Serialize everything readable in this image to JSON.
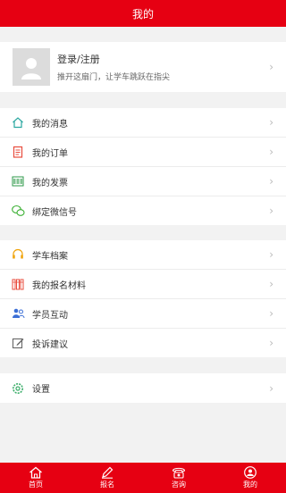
{
  "header": {
    "title": "我的"
  },
  "profile": {
    "title": "登录/注册",
    "subtitle": "推开这扇门，让学车跳跃在指尖"
  },
  "group1": [
    {
      "label": "我的消息",
      "icon": "home-icon"
    },
    {
      "label": "我的订单",
      "icon": "clipboard-icon"
    },
    {
      "label": "我的发票",
      "icon": "barcode-icon"
    },
    {
      "label": "绑定微信号",
      "icon": "wechat-icon"
    }
  ],
  "group2": [
    {
      "label": "学车档案",
      "icon": "headset-icon"
    },
    {
      "label": "我的报名材料",
      "icon": "books-icon"
    },
    {
      "label": "学员互动",
      "icon": "people-icon"
    },
    {
      "label": "投诉建议",
      "icon": "edit-icon"
    }
  ],
  "group3": [
    {
      "label": "设置",
      "icon": "gear-icon"
    }
  ],
  "tabs": [
    {
      "label": "首页",
      "icon": "home-icon"
    },
    {
      "label": "报名",
      "icon": "pen-icon"
    },
    {
      "label": "咨询",
      "icon": "phone-icon"
    },
    {
      "label": "我的",
      "icon": "user-icon"
    }
  ],
  "colors": {
    "brand": "#e60012",
    "background": "#f2f2f2",
    "chevron": "#bbbbbb"
  }
}
